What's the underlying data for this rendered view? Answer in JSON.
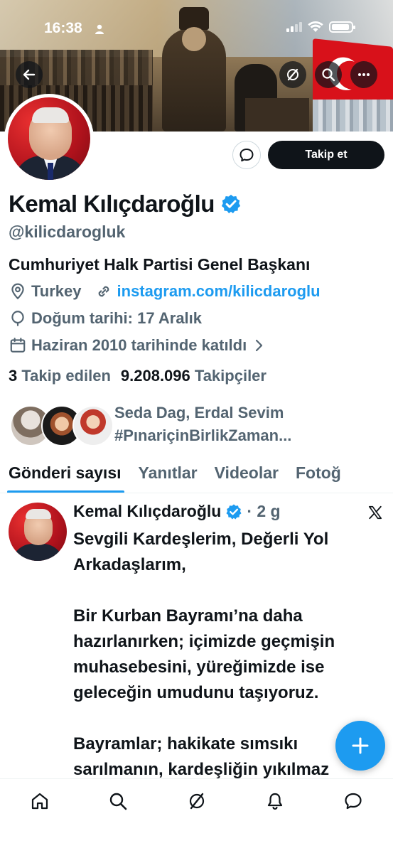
{
  "status_bar": {
    "time": "16:38"
  },
  "profile": {
    "name": "Kemal Kılıçdaroğlu",
    "handle": "@kilicdarogluk",
    "bio": "Cumhuriyet Halk Partisi Genel Başkanı",
    "location": "Turkey",
    "website": "instagram.com/kilicdaroglu",
    "birthday": "Doğum tarihi: 17 Aralık",
    "joined": "Haziran 2010 tarihinde katıldı",
    "following_count": "3",
    "following_label": "Takip edilen",
    "followers_count": "9.208.096",
    "followers_label": "Takipçiler",
    "followers_you_know": "Seda Dag, Erdal Sevim #PınariçinBirlikZaman...",
    "follow_button": "Takip et"
  },
  "tabs": [
    {
      "label": "Gönderi sayısı",
      "active": true
    },
    {
      "label": "Yanıtlar",
      "active": false
    },
    {
      "label": "Videolar",
      "active": false
    },
    {
      "label": "Fotoğ",
      "active": false
    }
  ],
  "tweet": {
    "author": "Kemal Kılıçdaroğlu",
    "time": "· 2 g",
    "text": "Sevgili Kardeşlerim, Değerli Yol Arkadaşlarım,\n\nBir Kurban Bayramı’na daha hazırlanırken; içimizde geçmişin muhasebesini, yüreğimizde ise geleceğin umudunu taşıyoruz.\n\nBayramlar; hakikate sımsıkı sarılmanın, kardeşliğin yıkılmaz"
  },
  "colors": {
    "accent": "#1d9bf0",
    "text": "#0f1419",
    "secondary": "#536471",
    "flag_red": "#d8111a"
  },
  "icons": [
    "back-arrow-icon",
    "grok-icon",
    "search-icon",
    "more-icon",
    "message-icon",
    "verified-badge-icon",
    "location-icon",
    "link-icon",
    "birthday-icon",
    "calendar-icon",
    "chevron-right-icon",
    "x-logo-icon",
    "compose-plus-icon",
    "home-icon",
    "search-nav-icon",
    "grok-nav-icon",
    "notifications-icon",
    "messages-icon"
  ]
}
